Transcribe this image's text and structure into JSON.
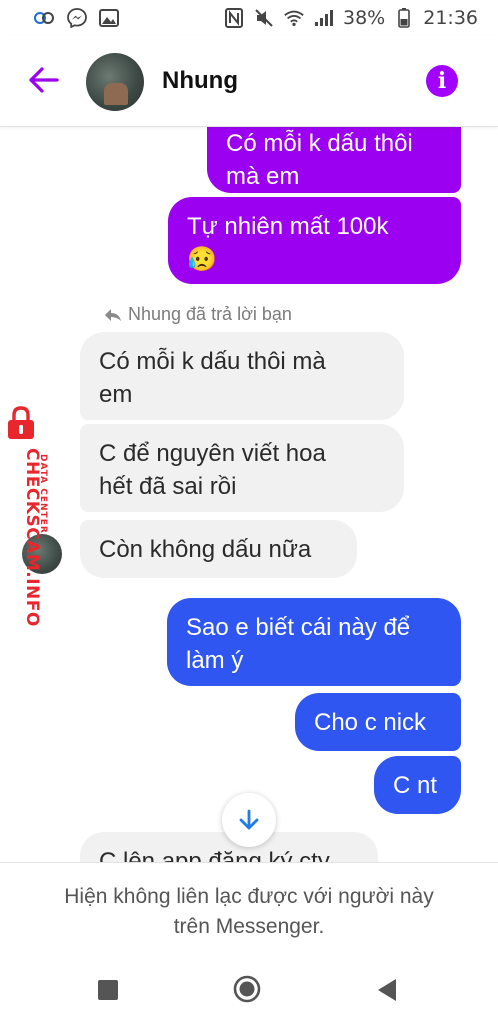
{
  "status_bar": {
    "battery": "38%",
    "time": "21:36"
  },
  "header": {
    "contact_name": "Nhung",
    "info_glyph": "i"
  },
  "conversation": {
    "reply_note": "Nhung đã trả lời bạn",
    "messages": [
      {
        "sender": "me",
        "color": "#9c00f0",
        "text": "Có mỗi k dấu thôi\nmà em"
      },
      {
        "sender": "me",
        "color": "#9c00f0",
        "text": "Tự nhiên mất 100k\n😥"
      },
      {
        "sender": "Nhung",
        "text": "Có mỗi k dấu thôi mà\nem"
      },
      {
        "sender": "Nhung",
        "text": "C để nguyên viết hoa\nhết đã sai rồi"
      },
      {
        "sender": "Nhung",
        "text": "Còn không dấu nữa"
      },
      {
        "sender": "me",
        "color": "#2f56f0",
        "text": "Sao e biết cái này để\nlàm ý"
      },
      {
        "sender": "me",
        "color": "#2f56f0",
        "text": "Cho c nick"
      },
      {
        "sender": "me",
        "color": "#2f56f0",
        "text": "C nt"
      },
      {
        "sender": "Nhung",
        "text": "C lên app đăng ký cty"
      }
    ]
  },
  "watermark": {
    "brand": "CHECKSCAM.INFO",
    "tagline": "DATA CENTER"
  },
  "footer": {
    "notice": "Hiện không liên lạc được với người này\ntrên Messenger."
  },
  "icons": {
    "back": "arrow-left-icon",
    "info": "info-icon",
    "scroll_down": "arrow-down-icon",
    "nav_recent": "square-icon",
    "nav_home": "circle-icon",
    "nav_back": "triangle-icon"
  },
  "colors": {
    "accent_purple": "#9c00f0",
    "accent_blue": "#2f56f0",
    "incoming_bg": "#f1f1f1"
  }
}
